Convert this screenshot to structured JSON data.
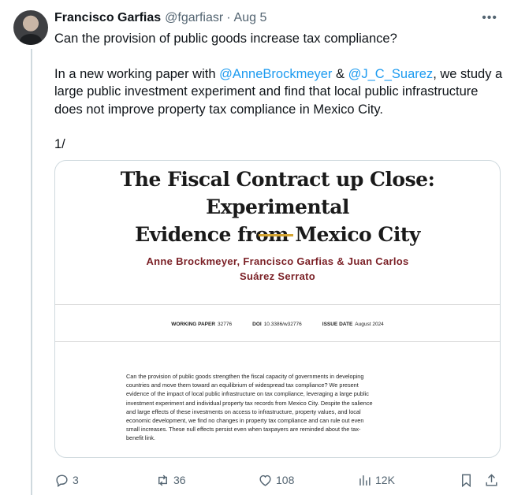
{
  "author": {
    "name": "Francisco Garfias",
    "handle": "@fgarfiasr",
    "separator": "·",
    "date": "Aug 5"
  },
  "more_label": "•••",
  "tweet": {
    "line1": "Can the provision of public goods increase tax compliance?",
    "para2_a": "In a new working paper with ",
    "mention1": "@AnneBrockmeyer",
    "para2_b": " & ",
    "mention2": "@J_C_Suarez",
    "para2_c": ", we study a large public investment experiment and find that local public infrastructure does not improve property tax compliance in Mexico City.",
    "thread_marker": "1/"
  },
  "paper": {
    "title_line1": "The Fiscal Contract up Close: Experimental",
    "title_line2": "Evidence from Mexico City",
    "authors_line1": "Anne Brockmeyer, Francisco Garfias & Juan Carlos",
    "authors_line2": "Suárez Serrato",
    "wp_label": "WORKING PAPER",
    "wp_value": "32776",
    "doi_label": "DOI",
    "doi_value": "10.3386/w32776",
    "issue_label": "ISSUE DATE",
    "issue_value": "August 2024",
    "abstract": [
      "Can the provision of public goods strengthen the fiscal capacity of governments in developing",
      "countries and move them toward an equilibrium of widespread tax compliance? We present",
      "evidence of the impact of local public infrastructure on tax compliance, leveraging a large public",
      "investment experiment and individual property tax records from Mexico City. Despite the salience",
      "and large effects of these investments on access to infrastructure, property values, and local",
      "economic development, we find no changes in property tax compliance and can rule out even",
      "small increases. These null effects persist even when taxpayers are reminded about the tax-",
      "benefit link."
    ]
  },
  "actions": {
    "replies": "3",
    "reposts": "36",
    "likes": "108",
    "views": "12K"
  },
  "colors": {
    "accent": "#1d9bf0",
    "muted": "#536471",
    "gold": "#d4a432",
    "author_red": "#7a1f25"
  }
}
